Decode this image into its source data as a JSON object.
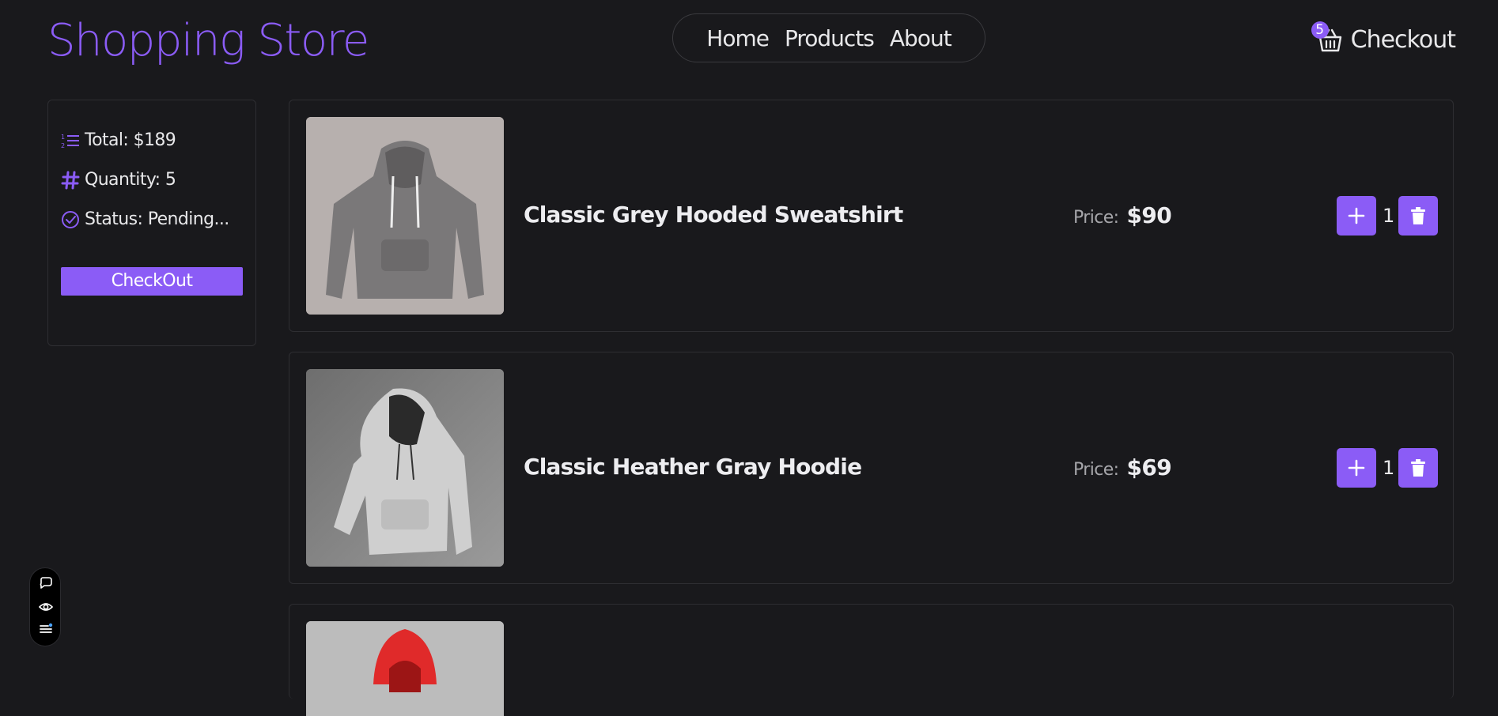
{
  "brand": "Shopping Store",
  "nav": {
    "home": "Home",
    "products": "Products",
    "about": "About"
  },
  "cart": {
    "count": "5",
    "label": "Checkout",
    "icon": "basket-icon"
  },
  "summary": {
    "total": "Total: $189",
    "quantity": "Quantity: 5",
    "status": "Status: Pending...",
    "button": "CheckOut",
    "icons": [
      "ordered-list-icon",
      "hash-icon",
      "check-circle-icon"
    ]
  },
  "products": [
    {
      "title": "Classic Grey Hooded Sweatshirt",
      "price_label": "Price:",
      "price": "$90",
      "qty": "1",
      "color": "#7a7879"
    },
    {
      "title": "Classic Heather Gray Hoodie",
      "price_label": "Price:",
      "price": "$69",
      "qty": "1",
      "color": "#c9c9c9"
    },
    {
      "title": "",
      "price_label": "",
      "price": "",
      "qty": "",
      "color": "#e02a2a"
    }
  ],
  "colors": {
    "accent": "#8b5cf6",
    "background": "#19191c",
    "border": "#2e2e32"
  },
  "floating_toolbar": [
    "comment-icon",
    "eye-icon",
    "menu-icon"
  ]
}
